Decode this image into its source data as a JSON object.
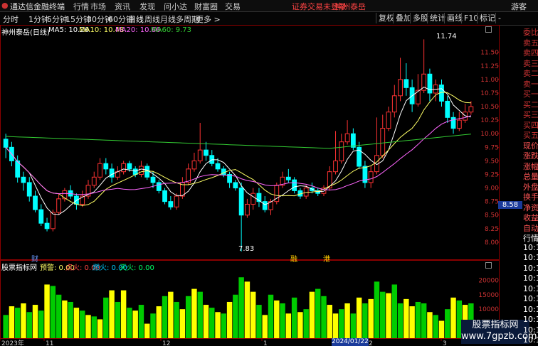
{
  "app": {
    "name": "通达信金融终端",
    "menus": [
      "行情",
      "市场",
      "资讯",
      "发现",
      "问小达",
      "财富圈",
      "交易"
    ],
    "alert": "证券交易未登录",
    "stock_tag": "神州泰岳",
    "guest": "游客"
  },
  "periods": [
    "分时",
    "1分钟",
    "5分钟",
    "15分钟",
    "30分钟",
    "60分钟",
    "日线",
    "周线",
    "月线",
    "多周期",
    "更多 >"
  ],
  "active_period": "日线",
  "toolbar_buttons": [
    "复权",
    "叠加",
    "多股",
    "统计",
    "画线",
    "F10",
    "标记",
    "-"
  ],
  "main_header": {
    "name": "神州泰岳(日线)",
    "ma5": "MA5: 10.26",
    "ma10": "MA10: 10.48",
    "ma20": "MA20: 10.66",
    "ma60": "MA60: 9.73"
  },
  "price_axis": [
    "11.50",
    "11.25",
    "11.00",
    "10.75",
    "10.50",
    "10.25",
    "10.00",
    "9.75",
    "9.50",
    "9.25",
    "9.00",
    "8.75",
    "8.50",
    "8.25",
    "8.00"
  ],
  "current_price_tag": "8.58",
  "annotations": {
    "high": "11.74",
    "low": "7.83"
  },
  "event_markers": [
    "财",
    "融",
    "港"
  ],
  "indicator_header": {
    "name": "股票指标网",
    "warn": "预警: 0.00",
    "dianhuo": "点火: 0.00",
    "ranhuo": "燃火: 0.00",
    "miehuo": "灭火: 0.00"
  },
  "volume_axis": [
    "20000",
    "15000",
    "10000",
    "5000"
  ],
  "date_axis": [
    "2023年",
    "11",
    "12",
    "1",
    "2024/01/22/一",
    "2",
    "3"
  ],
  "right_tabs": [
    "委比",
    "卖五",
    "卖四",
    "卖三",
    "卖二",
    "卖一",
    "买一",
    "买二",
    "买三",
    "买四",
    "买五",
    "现价",
    "涨跌",
    "涨幅",
    "总量",
    "外盘",
    "换手",
    "净资",
    "收益",
    "自动",
    "行情",
    "10:1",
    "10:1",
    "10:1",
    "10:1",
    "10:1",
    "10:1",
    "10:1",
    "10:1",
    "10:1",
    "10:1"
  ],
  "watermark": "股票指标网\nwww.7gpzb.com",
  "colors": {
    "up": "#ff3333",
    "down": "#00ffff",
    "ma5": "#ffffff",
    "ma10": "#ffff66",
    "ma20": "#ff66ff",
    "ma60": "#33cc33",
    "vol_yellow": "#ffff00",
    "vol_green": "#00cc00"
  },
  "chart_data": {
    "type": "candlestick",
    "price_range": [
      7.75,
      11.85
    ],
    "candles": [
      [
        9.9,
        9.75,
        10.0,
        9.55
      ],
      [
        9.75,
        9.5,
        9.85,
        9.4
      ],
      [
        9.5,
        9.2,
        9.6,
        9.1
      ],
      [
        9.2,
        9.1,
        9.3,
        8.95
      ],
      [
        9.1,
        8.85,
        9.2,
        8.75
      ],
      [
        8.85,
        8.6,
        8.95,
        8.55
      ],
      [
        8.6,
        8.35,
        8.7,
        8.3
      ],
      [
        8.35,
        8.25,
        8.45,
        8.2
      ],
      [
        8.25,
        8.55,
        8.6,
        8.2
      ],
      [
        8.55,
        8.8,
        8.9,
        8.5
      ],
      [
        8.8,
        8.95,
        9.0,
        8.75
      ],
      [
        8.95,
        8.85,
        9.05,
        8.8
      ],
      [
        8.85,
        8.7,
        8.9,
        8.6
      ],
      [
        8.7,
        8.85,
        8.95,
        8.65
      ],
      [
        8.85,
        9.05,
        9.15,
        8.8
      ],
      [
        9.05,
        9.2,
        9.3,
        9.0
      ],
      [
        9.2,
        9.45,
        9.55,
        9.15
      ],
      [
        9.45,
        9.35,
        9.55,
        9.25
      ],
      [
        9.35,
        9.2,
        9.45,
        9.1
      ],
      [
        9.2,
        9.3,
        9.4,
        9.15
      ],
      [
        9.3,
        9.45,
        9.5,
        9.25
      ],
      [
        9.45,
        9.35,
        9.5,
        9.3
      ],
      [
        9.35,
        9.25,
        9.4,
        9.2
      ],
      [
        9.25,
        9.4,
        9.5,
        9.2
      ],
      [
        9.4,
        9.2,
        9.45,
        9.15
      ],
      [
        9.2,
        9.1,
        9.3,
        9.0
      ],
      [
        9.1,
        8.95,
        9.15,
        8.9
      ],
      [
        8.95,
        8.75,
        9.0,
        8.7
      ],
      [
        8.75,
        8.65,
        8.85,
        8.6
      ],
      [
        8.65,
        8.85,
        8.9,
        8.6
      ],
      [
        8.85,
        9.1,
        9.2,
        8.8
      ],
      [
        9.1,
        9.35,
        9.45,
        9.05
      ],
      [
        9.35,
        9.5,
        9.65,
        9.3
      ],
      [
        9.5,
        9.7,
        10.2,
        9.45
      ],
      [
        9.7,
        9.6,
        9.85,
        9.5
      ],
      [
        9.6,
        9.45,
        9.7,
        9.4
      ],
      [
        9.45,
        9.35,
        9.55,
        9.3
      ],
      [
        9.35,
        9.25,
        9.4,
        9.2
      ],
      [
        9.25,
        9.1,
        9.3,
        9.0
      ],
      [
        9.1,
        9.0,
        9.15,
        8.95
      ],
      [
        9.0,
        8.5,
        9.1,
        7.83
      ],
      [
        8.5,
        8.7,
        8.8,
        8.45
      ],
      [
        8.7,
        8.9,
        9.0,
        8.6
      ],
      [
        8.9,
        8.75,
        9.0,
        8.65
      ],
      [
        8.75,
        8.6,
        8.85,
        8.55
      ],
      [
        8.6,
        8.75,
        8.8,
        8.5
      ],
      [
        8.75,
        9.05,
        9.1,
        8.7
      ],
      [
        9.05,
        9.2,
        9.3,
        9.0
      ],
      [
        9.2,
        9.15,
        9.35,
        9.1
      ],
      [
        9.15,
        8.95,
        9.2,
        8.9
      ],
      [
        8.95,
        8.85,
        9.0,
        8.8
      ],
      [
        8.85,
        9.0,
        9.05,
        8.8
      ],
      [
        9.0,
        8.95,
        9.1,
        8.9
      ],
      [
        8.95,
        8.9,
        9.0,
        8.85
      ],
      [
        8.9,
        9.0,
        9.05,
        8.85
      ],
      [
        9.0,
        9.3,
        9.4,
        8.95
      ],
      [
        9.3,
        9.5,
        10.05,
        9.25
      ],
      [
        9.5,
        9.85,
        10.0,
        9.45
      ],
      [
        9.85,
        10.0,
        10.25,
        9.8
      ],
      [
        10.0,
        9.75,
        10.1,
        9.7
      ],
      [
        9.75,
        9.4,
        9.85,
        9.35
      ],
      [
        9.4,
        9.1,
        9.5,
        9.0
      ],
      [
        9.1,
        9.3,
        9.4,
        9.0
      ],
      [
        9.3,
        9.6,
        10.3,
        9.25
      ],
      [
        9.6,
        10.1,
        10.35,
        9.55
      ],
      [
        10.1,
        10.4,
        10.5,
        10.05
      ],
      [
        10.4,
        10.7,
        10.9,
        10.3
      ],
      [
        10.7,
        11.0,
        11.4,
        10.6
      ],
      [
        11.0,
        10.85,
        11.3,
        10.7
      ],
      [
        10.85,
        10.55,
        11.0,
        10.4
      ],
      [
        10.55,
        10.8,
        11.1,
        10.5
      ],
      [
        10.8,
        11.1,
        11.74,
        10.75
      ],
      [
        11.1,
        10.75,
        11.2,
        10.6
      ],
      [
        10.75,
        10.9,
        11.0,
        10.6
      ],
      [
        10.9,
        10.6,
        11.0,
        10.5
      ],
      [
        10.6,
        10.3,
        10.7,
        10.2
      ],
      [
        10.3,
        10.1,
        10.4,
        10.0
      ],
      [
        10.1,
        10.25,
        10.4,
        10.05
      ],
      [
        10.25,
        10.4,
        10.55,
        10.2
      ],
      [
        10.4,
        10.5,
        10.6,
        10.35
      ]
    ],
    "volume_range": [
      0,
      24000
    ],
    "volumes": [
      8000,
      11000,
      10500,
      12000,
      9000,
      11500,
      9500,
      18500,
      18000,
      15000,
      13000,
      12500,
      10500,
      9500,
      8000,
      7500,
      6500,
      14000,
      16500,
      12500,
      16500,
      10500,
      9500,
      11500,
      5000,
      8500,
      11000,
      14500,
      16000,
      12500,
      10000,
      14500,
      17000,
      16000,
      11500,
      10500,
      9000,
      8500,
      12500,
      15000,
      21000,
      19500,
      16000,
      11500,
      8000,
      15000,
      13000,
      12000,
      8500,
      14000,
      9000,
      10000,
      16000,
      17000,
      14500,
      11500,
      8500,
      10000,
      12000,
      8500,
      14000,
      12000,
      13500,
      19500,
      16000,
      15500,
      18500,
      12000,
      13500,
      11000,
      12500,
      12000,
      9000,
      8000,
      6000,
      10000,
      14000,
      13000,
      11500,
      12000
    ],
    "vol_colors": [
      "g",
      "y",
      "g",
      "y",
      "g",
      "y",
      "g",
      "y",
      "g",
      "g",
      "y",
      "g",
      "y",
      "g",
      "y",
      "g",
      "y",
      "g",
      "y",
      "g",
      "y",
      "g",
      "y",
      "g",
      "y",
      "g",
      "y",
      "g",
      "y",
      "g",
      "y",
      "g",
      "y",
      "g",
      "y",
      "g",
      "y",
      "g",
      "y",
      "g",
      "g",
      "y",
      "y",
      "g",
      "y",
      "g",
      "y",
      "g",
      "y",
      "g",
      "y",
      "g",
      "y",
      "g",
      "g",
      "y",
      "y",
      "g",
      "y",
      "g",
      "y",
      "g",
      "y",
      "g",
      "g",
      "y",
      "g",
      "g",
      "y",
      "y",
      "g",
      "g",
      "y",
      "g",
      "y",
      "g",
      "y",
      "g",
      "y",
      "g"
    ]
  }
}
